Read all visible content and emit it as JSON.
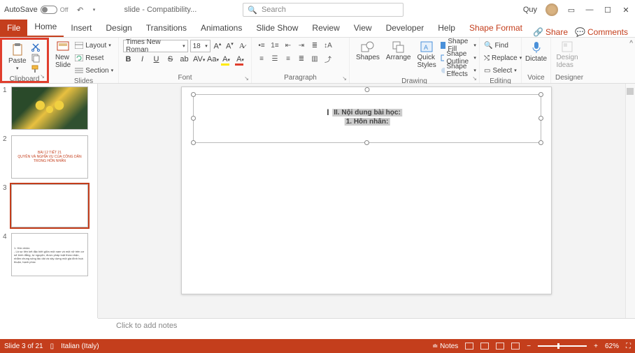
{
  "titlebar": {
    "autosave_label": "AutoSave",
    "autosave_state": "Off",
    "document": "slide  -  Compatibility...",
    "search_placeholder": "Search",
    "user": "Quy"
  },
  "tabs": {
    "file": "File",
    "items": [
      "Home",
      "Insert",
      "Design",
      "Transitions",
      "Animations",
      "Slide Show",
      "Review",
      "View",
      "Developer",
      "Help",
      "Shape Format"
    ],
    "active": 0,
    "share": "Share",
    "comments": "Comments"
  },
  "ribbon": {
    "clipboard": {
      "paste": "Paste",
      "label": "Clipboard"
    },
    "slides": {
      "new_slide": "New\nSlide",
      "layout": "Layout",
      "reset": "Reset",
      "section": "Section",
      "label": "Slides"
    },
    "font": {
      "name": "Times New Roman",
      "size": "18",
      "label": "Font"
    },
    "paragraph": {
      "label": "Paragraph"
    },
    "drawing": {
      "shapes": "Shapes",
      "arrange": "Arrange",
      "quick_styles": "Quick\nStyles",
      "shape_fill": "Shape Fill",
      "shape_outline": "Shape Outline",
      "shape_effects": "Shape Effects",
      "label": "Drawing"
    },
    "editing": {
      "find": "Find",
      "replace": "Replace",
      "select": "Select",
      "label": "Editing"
    },
    "voice": {
      "dictate": "Dictate",
      "label": "Voice"
    },
    "designer": {
      "design_ideas": "Design\nIdeas",
      "label": "Designer"
    }
  },
  "thumbnails": [
    {
      "num": "1"
    },
    {
      "num": "2",
      "text": "BÀI 12 TIẾT 21\nQUYỀN VÀ NGHĨA VỤ CỦA CÔNG DÂN\nTRONG HÔN NHÂN"
    },
    {
      "num": "3"
    },
    {
      "num": "4",
      "text": "1. Hôn nhân:\n- Là sự liên kết đặc biệt giữa một nam và một nữ trên cơ sở bình đẳng, tự nguyện, được pháp luật thừa nhận, nhằm chung sống lâu dài và xây dựng một gia đình hoà thuận, hạnh phúc"
    }
  ],
  "slide": {
    "line1": "II. Nội dung bài học:",
    "line2": "1. Hôn nhân:"
  },
  "notes_placeholder": "Click to add notes",
  "status": {
    "slide_info": "Slide 3 of 21",
    "language": "Italian (Italy)",
    "notes": "Notes",
    "zoom": "62%"
  }
}
